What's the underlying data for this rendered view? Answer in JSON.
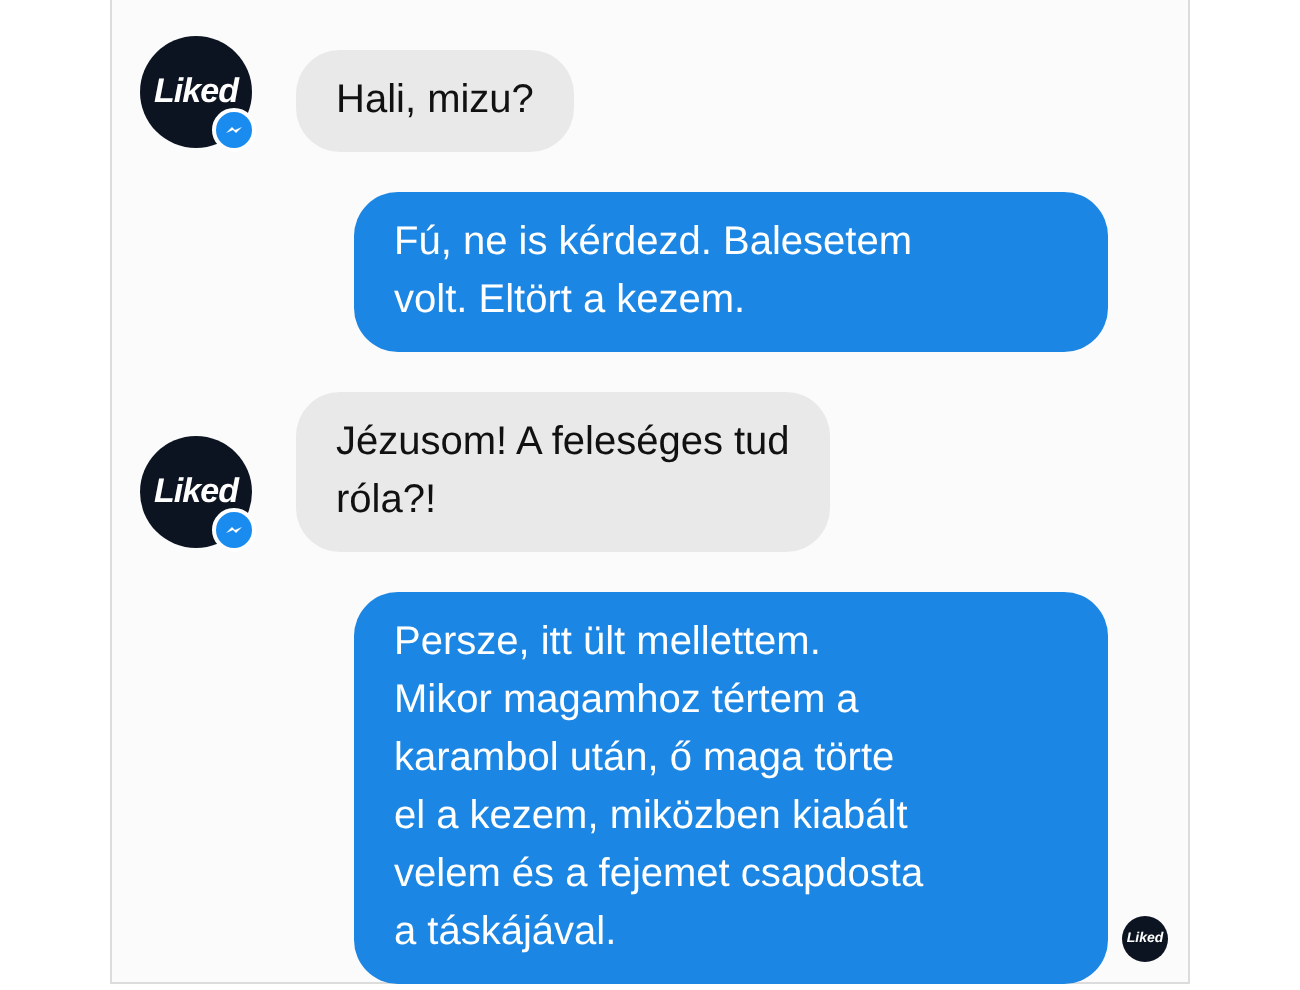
{
  "messages": [
    {
      "kind": "incoming",
      "avatar": "Liked",
      "text": "Hali, mizu?"
    },
    {
      "kind": "outgoing",
      "text": "Fú, ne is kérdezd. Balesetem\nvolt. Eltört a kezem."
    },
    {
      "kind": "incoming",
      "avatar": "Liked",
      "text": "Jézusom! A feleséges tud\nróla?!"
    },
    {
      "kind": "outgoing",
      "text": "Persze, itt ült mellettem.\nMikor magamhoz tértem a\nkarambol után, ő maga törte\nel a kezem, miközben kiabált\nvelem és a fejemet csapdosta\na táskájával."
    }
  ],
  "read_receipt": {
    "avatar": "Liked"
  }
}
